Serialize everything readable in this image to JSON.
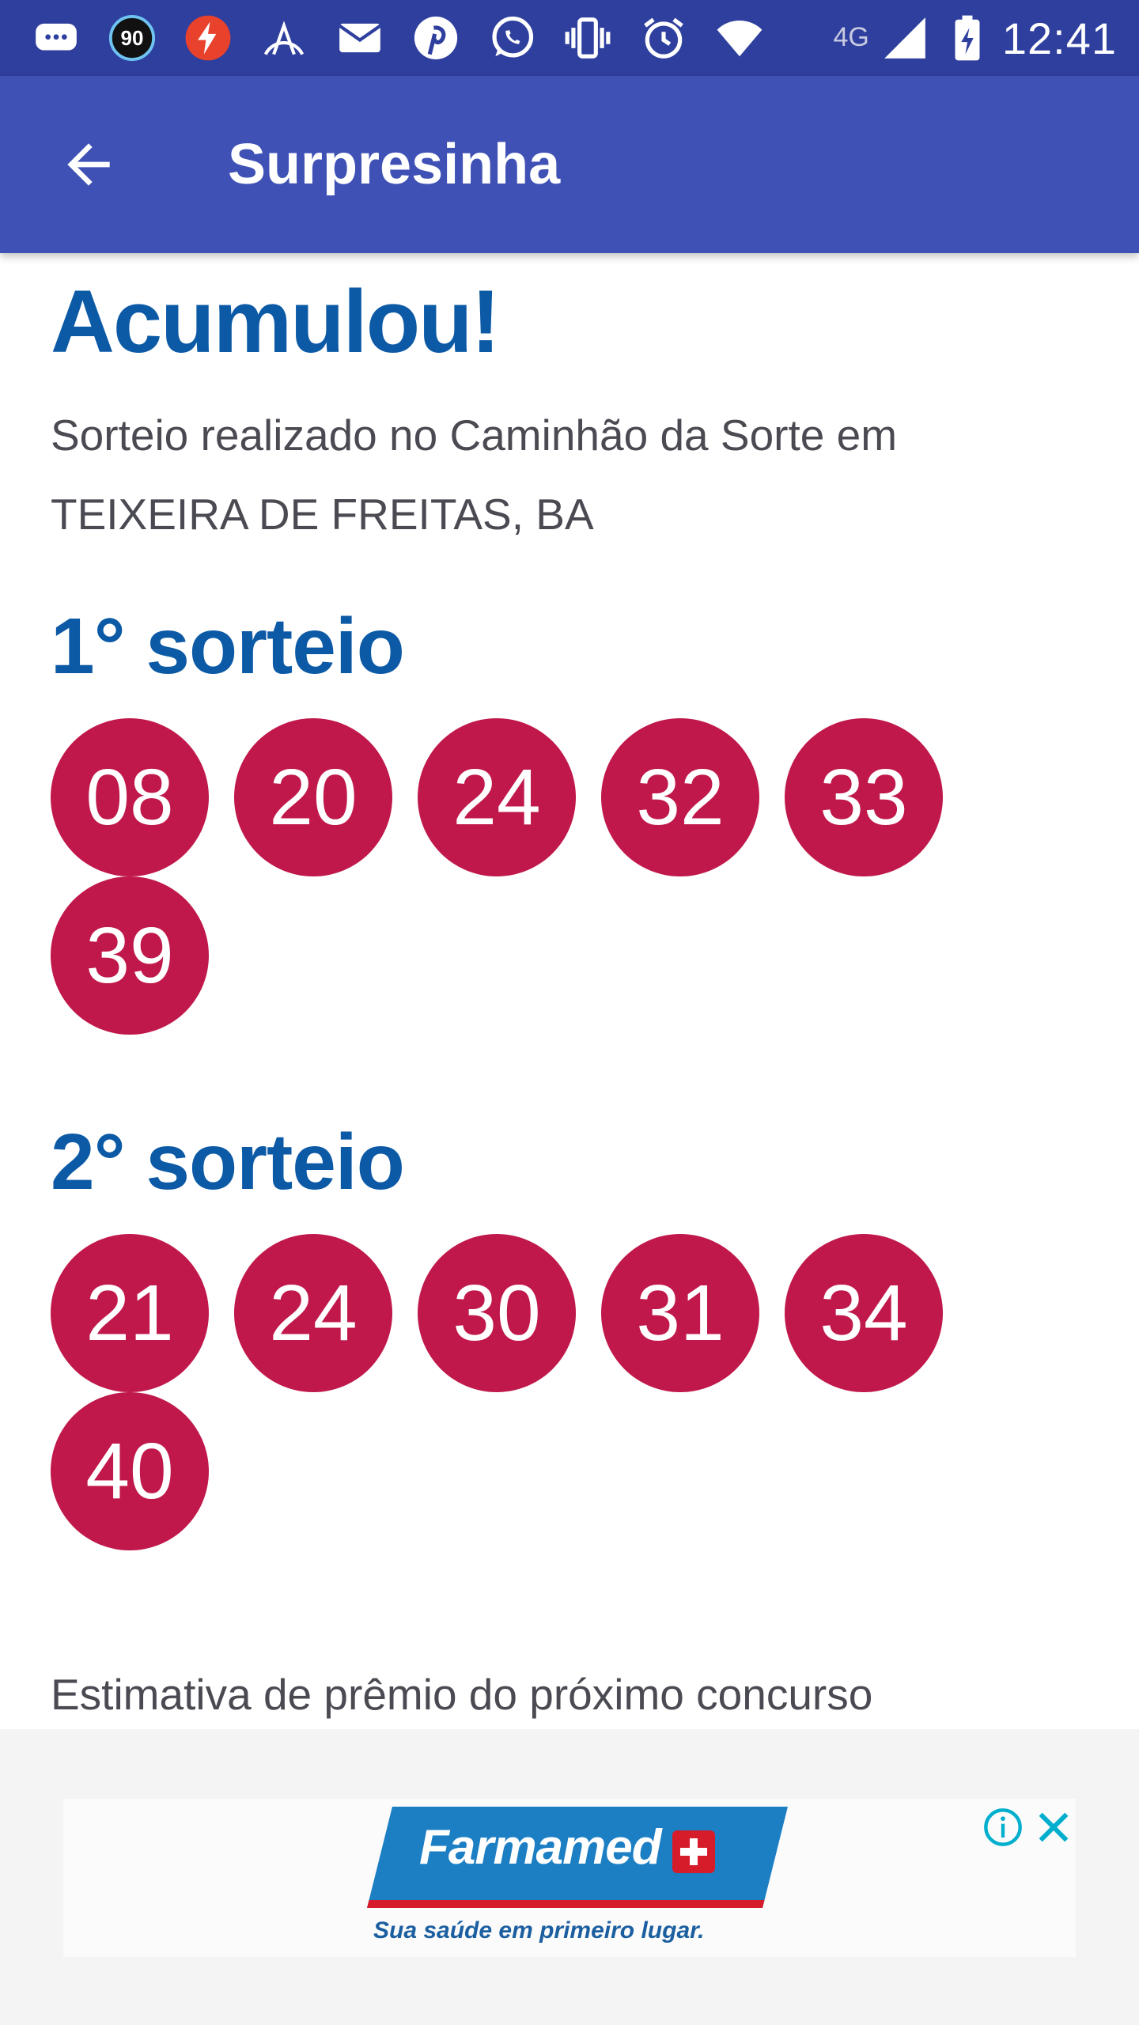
{
  "status_bar": {
    "time": "12:41",
    "network": "4G",
    "badge_count": "90",
    "icons": [
      "chat-bubble-icon",
      "speedometer-badge-icon",
      "flash-icon",
      "arc-app-icon",
      "email-icon",
      "pinterest-icon",
      "whatsapp-icon",
      "vibrate-icon",
      "alarm-icon",
      "wifi-icon",
      "signal-icon",
      "battery-charging-icon"
    ]
  },
  "app_bar": {
    "title": "Surpresinha",
    "back_icon": "arrow-back-icon"
  },
  "result": {
    "headline": "Acumulou!",
    "draw_info": "Sorteio realizado no Caminhão da Sorte em TEIXEIRA DE FREITAS, BA"
  },
  "draws": [
    {
      "title": "1° sorteio",
      "numbers": [
        "08",
        "20",
        "24",
        "32",
        "33",
        "39"
      ]
    },
    {
      "title": "2° sorteio",
      "numbers": [
        "21",
        "24",
        "30",
        "31",
        "34",
        "40"
      ]
    }
  ],
  "prize": {
    "label": "Estimativa de prêmio do próximo concurso"
  },
  "ad": {
    "brand": "Farmamed",
    "slogan": "Sua saúde em primeiro lugar.",
    "colors": {
      "brand_blue": "#1c7fc4",
      "brand_red": "#d61c2a"
    }
  },
  "colors": {
    "status_bar": "#2f3f9e",
    "app_bar": "#3f51b5",
    "heading_blue": "#0c5aa6",
    "ball": "#c0184a"
  }
}
